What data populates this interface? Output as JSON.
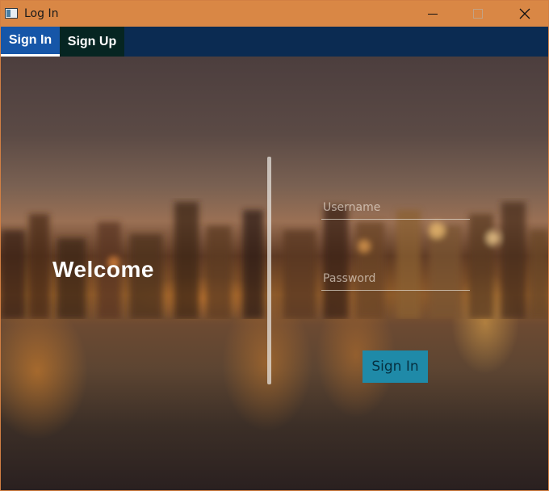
{
  "window": {
    "title": "Log In",
    "icons": {
      "app": "app-window-icon",
      "minimize": "minimize-icon",
      "maximize": "maximize-icon",
      "close": "close-icon"
    }
  },
  "tabs": [
    {
      "label": "Sign In",
      "selected": true
    },
    {
      "label": "Sign Up",
      "selected": false
    }
  ],
  "login": {
    "welcome_text": "Welcome",
    "username_placeholder": "Username",
    "username_value": "",
    "password_placeholder": "Password",
    "password_value": "",
    "signin_label": "Sign In"
  },
  "colors": {
    "titlebar": "#d98745",
    "tabbar": "#0b2b52",
    "tab_selected": "#1656a8",
    "tab_unselected": "#062522",
    "button": "#1f8aa8",
    "button_text": "#063040"
  }
}
